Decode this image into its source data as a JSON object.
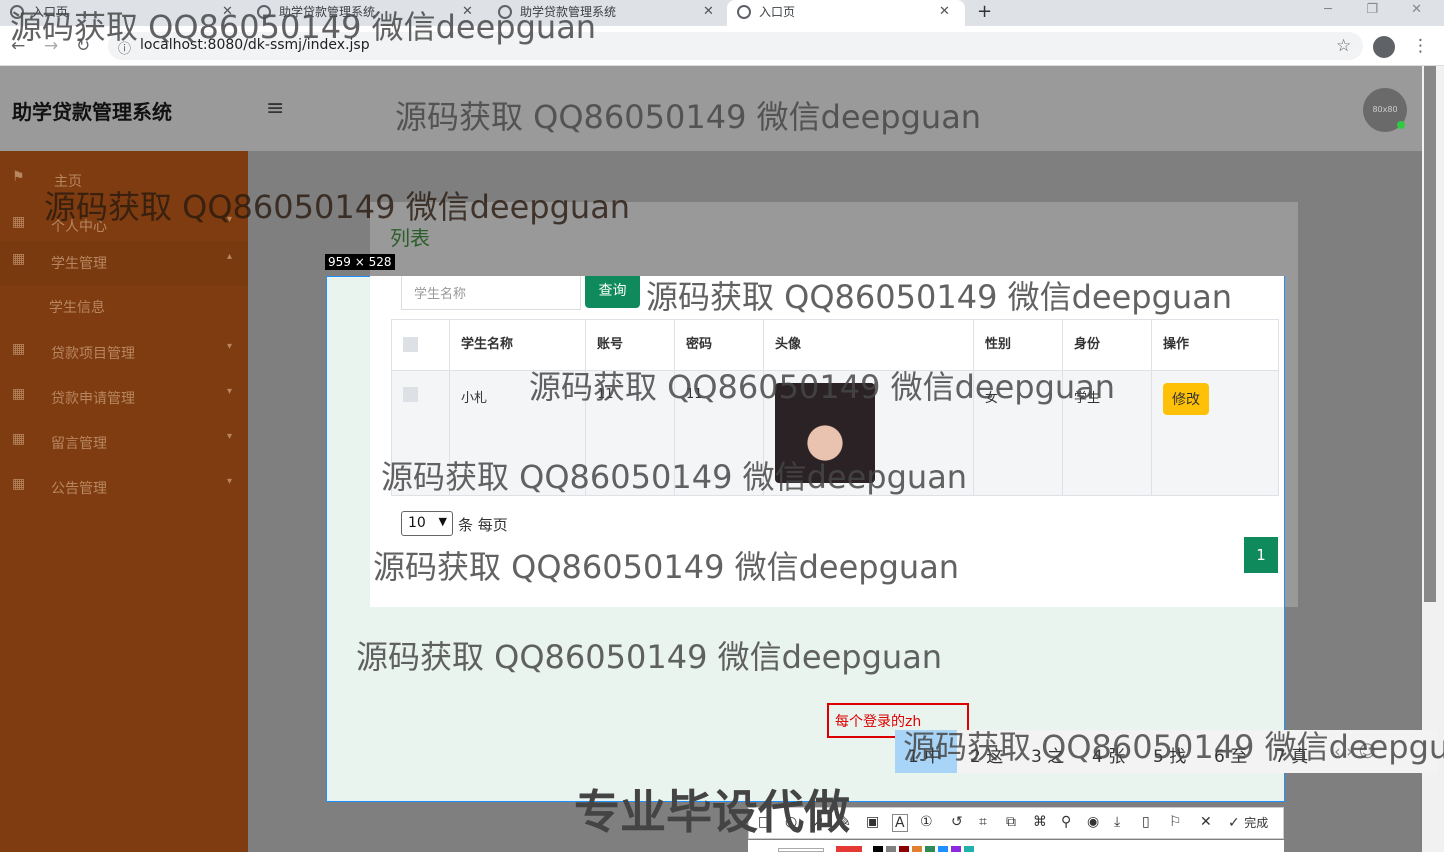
{
  "browser": {
    "tabs": [
      {
        "label": "入口页",
        "active": false
      },
      {
        "label": "助学贷款管理系统",
        "active": false
      },
      {
        "label": "助学贷款管理系统",
        "active": false
      },
      {
        "label": "入口页",
        "active": true
      }
    ],
    "new_tab": "+",
    "url": "localhost:8080/dk-ssmj/index.jsp"
  },
  "header": {
    "brand": "助学贷款管理系统",
    "avatar_text": "80x80"
  },
  "sidebar": {
    "items": [
      {
        "label": "主页",
        "icon": "flag-icon",
        "caret": false
      },
      {
        "label": "个人中心",
        "icon": "grid-icon",
        "caret": true
      },
      {
        "label": "学生管理",
        "icon": "grid-icon",
        "caret": true,
        "expanded": true
      },
      {
        "label": "学生信息",
        "icon": "",
        "caret": false,
        "sub": true
      },
      {
        "label": "贷款项目管理",
        "icon": "grid-icon",
        "caret": true
      },
      {
        "label": "贷款申请管理",
        "icon": "grid-icon",
        "caret": true
      },
      {
        "label": "留言管理",
        "icon": "grid-icon",
        "caret": true
      },
      {
        "label": "公告管理",
        "icon": "grid-icon",
        "caret": true
      }
    ]
  },
  "main": {
    "title": "列表",
    "search": {
      "placeholder": "学生名称",
      "button": "查询"
    },
    "table": {
      "headers": [
        "学生名称",
        "账号",
        "密码",
        "头像",
        "性别",
        "身份",
        "操作"
      ],
      "rows": [
        {
          "name": "小札",
          "account": "11",
          "password": "11",
          "gender": "女",
          "role": "学生",
          "action": "修改"
        }
      ]
    },
    "page_size": "10",
    "page_size_label": "条 每页",
    "current_page": "1"
  },
  "snip": {
    "size_label": "959 × 528",
    "text_entry": "每个登录的zh",
    "toolbar_done": "完成",
    "palette": [
      "#e53935",
      "#000000",
      "#808080",
      "#8b0000",
      "#e08030",
      "#2e8b57",
      "#1e90ff",
      "#8a2be2",
      "#20b2aa"
    ]
  },
  "ime": {
    "candidates": [
      "1 中",
      "2 这",
      "3 之",
      "4 张",
      "5 找",
      "6 至",
      "7 真"
    ]
  },
  "watermark": {
    "text": "源码获取 QQ86050149 微信deepguan",
    "banner": "专业毕设代做"
  }
}
